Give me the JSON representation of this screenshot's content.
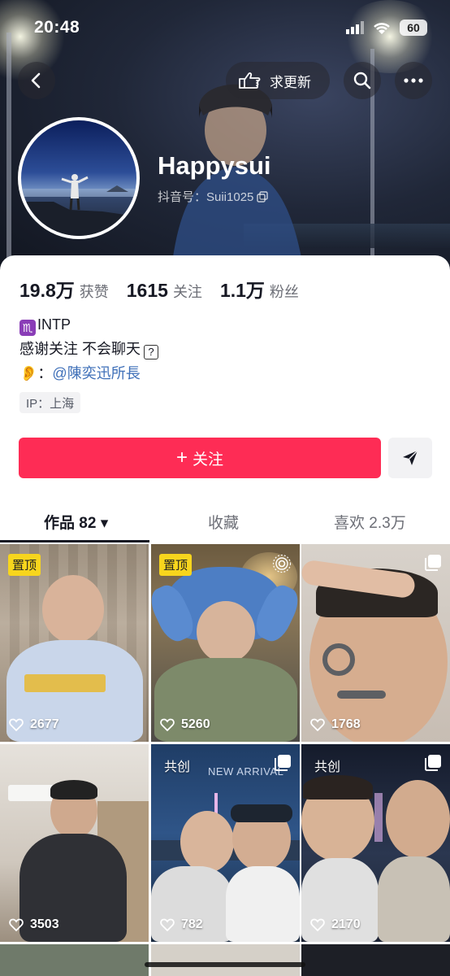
{
  "status_bar": {
    "time": "20:48",
    "battery": "60"
  },
  "header": {
    "update_request_label": "求更新"
  },
  "profile": {
    "name": "Happysui",
    "douyin_id": "抖音号：Suii1025",
    "stats": [
      {
        "value": "19.8万",
        "label": "获赞"
      },
      {
        "value": "1615",
        "label": "关注"
      },
      {
        "value": "1.1万",
        "label": "粉丝"
      }
    ],
    "bio": {
      "line1": "INTP",
      "zodiac": "♏",
      "line2": "感谢关注 不会聊天",
      "line2_box": "?",
      "line3_emoji": "👂",
      "line3_prefix": "：",
      "mention": "@陳奕迅所長"
    },
    "ip": "IP：上海"
  },
  "actions": {
    "follow_label": "关注",
    "follow_plus": "+"
  },
  "tabs": [
    {
      "label": "作品 82 ▾"
    },
    {
      "label": "收藏"
    },
    {
      "label": "喜欢 2.3万"
    }
  ],
  "videos": [
    {
      "likes": "2677",
      "badge": "置顶"
    },
    {
      "likes": "5260",
      "badge": "置顶"
    },
    {
      "likes": "1768"
    },
    {
      "likes": "3503"
    },
    {
      "likes": "782",
      "collab": "共创",
      "overlay_text": "NEW ARRIVAL"
    },
    {
      "likes": "2170",
      "collab": "共创"
    }
  ],
  "colors": {
    "accent": "#fe2c55",
    "mention": "#3e6fb8",
    "pin_badge": "#f7d51d",
    "text_primary": "#161823",
    "text_secondary": "#6d6f77"
  },
  "icons": [
    "back-icon",
    "hand-point-icon",
    "search-icon",
    "more-icon",
    "copy-icon",
    "send-icon",
    "heart-icon",
    "multi-photo-icon",
    "live-photo-icon",
    "wifi-icon",
    "signal-icon"
  ]
}
